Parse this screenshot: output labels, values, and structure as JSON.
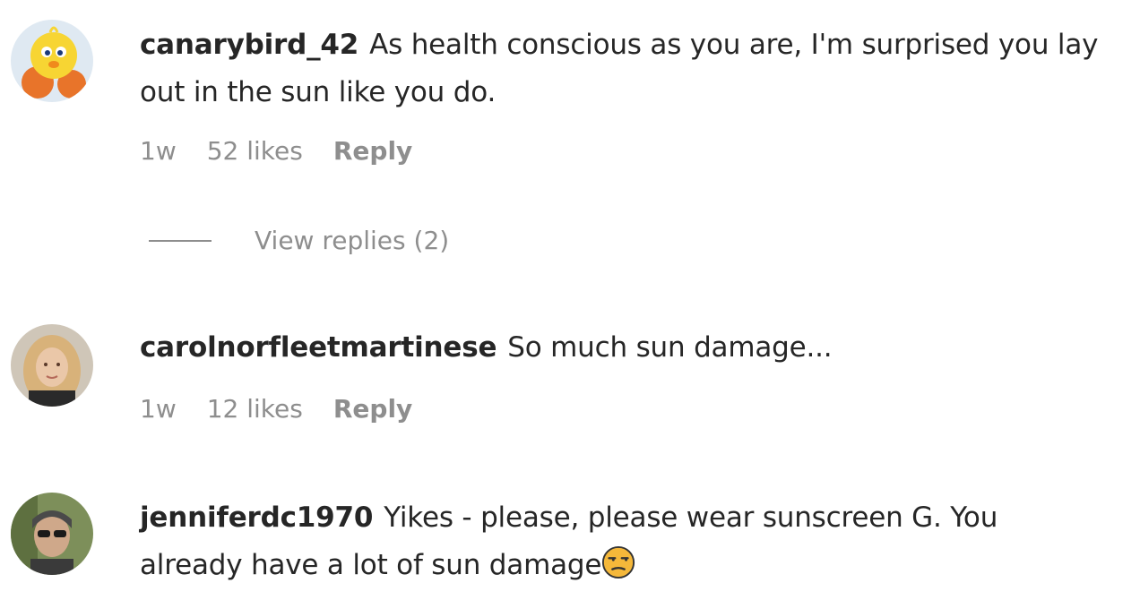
{
  "comments": [
    {
      "username": "canarybird_42",
      "text": "As health conscious as you are, I'm surprised you lay out in the sun like you do.",
      "time": "1w",
      "likes": "52 likes",
      "reply_label": "Reply",
      "view_replies": "View replies (2)"
    },
    {
      "username": "carolnorfleetmartinese",
      "text": "So much sun damage...",
      "time": "1w",
      "likes": "12 likes",
      "reply_label": "Reply"
    },
    {
      "username": "jenniferdc1970",
      "text": "Yikes - please, please wear sunscreen G. You already have a lot of sun damage",
      "emoji": "unamused-face-emoji"
    }
  ]
}
